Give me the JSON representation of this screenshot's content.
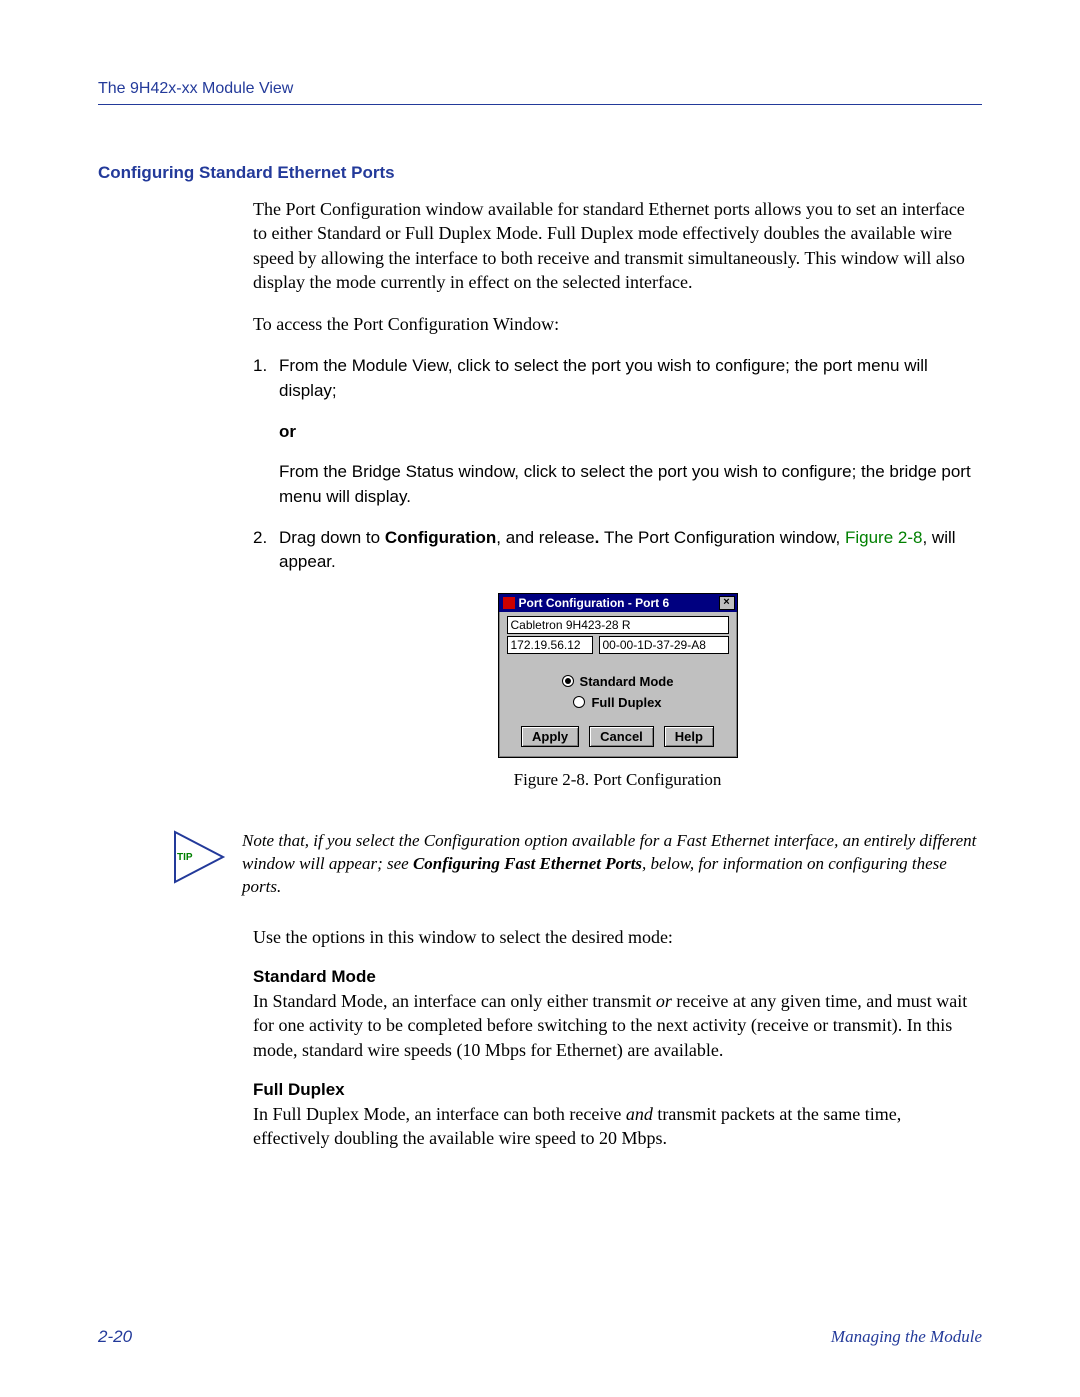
{
  "header": {
    "title": "The 9H42x-xx Module View"
  },
  "section": {
    "title": "Configuring Standard Ethernet Ports"
  },
  "intro": {
    "p1": "The Port Configuration window available for standard Ethernet ports allows you to set an interface to either Standard or Full Duplex Mode. Full Duplex mode effectively doubles the available wire speed by allowing the interface to both receive and transmit simultaneously. This window will also display the mode currently in effect on the selected interface.",
    "p2": "To access the Port Configuration Window:"
  },
  "steps": {
    "s1": {
      "num": "1.",
      "text": "From the Module View, click to select the port you wish to configure; the port menu will display;"
    },
    "or": "or",
    "s1b": "From the Bridge Status window, click to select the port you wish to configure; the bridge port menu will display.",
    "s2": {
      "num": "2.",
      "pre": "Drag down to ",
      "bold1": "Configuration",
      "mid1": ", and release",
      "dot": ". ",
      "mid2": "The Port Configuration window, ",
      "link": "Figure 2-8",
      "post": ", will appear."
    }
  },
  "dialog": {
    "title": "Port Configuration - Port 6",
    "device": "Cabletron 9H423-28 R",
    "ip": "172.19.56.12",
    "mac": "00-00-1D-37-29-A8",
    "opt_std": "Standard Mode",
    "opt_fd": "Full Duplex",
    "btn_apply": "Apply",
    "btn_cancel": "Cancel",
    "btn_help": "Help"
  },
  "fig": {
    "caption": "Figure 2-8. Port Configuration"
  },
  "tip": {
    "label": "TIP",
    "t1": "Note that, if you select the Configuration option available for a Fast Ethernet interface, an entirely different window will appear; see ",
    "bold": "Configuring Fast Ethernet Ports",
    "t2": ", below, for information on configuring these ports."
  },
  "usage": "Use the options in this window to select the desired mode:",
  "mode_std": {
    "h": "Standard Mode",
    "p_a": "In Standard Mode, an interface can only either transmit ",
    "or": "or",
    "p_b": " receive at any given time, and must wait for one activity to be completed before switching to the next activity (receive or transmit). In this mode, standard wire speeds (10 Mbps for Ethernet) are available."
  },
  "mode_fd": {
    "h": "Full Duplex",
    "p_a": "In Full Duplex Mode, an interface can both receive ",
    "and": "and",
    "p_b": " transmit packets at the same time, effectively doubling the available wire speed to 20 Mbps."
  },
  "footer": {
    "page": "2-20",
    "chapter": "Managing the Module"
  }
}
